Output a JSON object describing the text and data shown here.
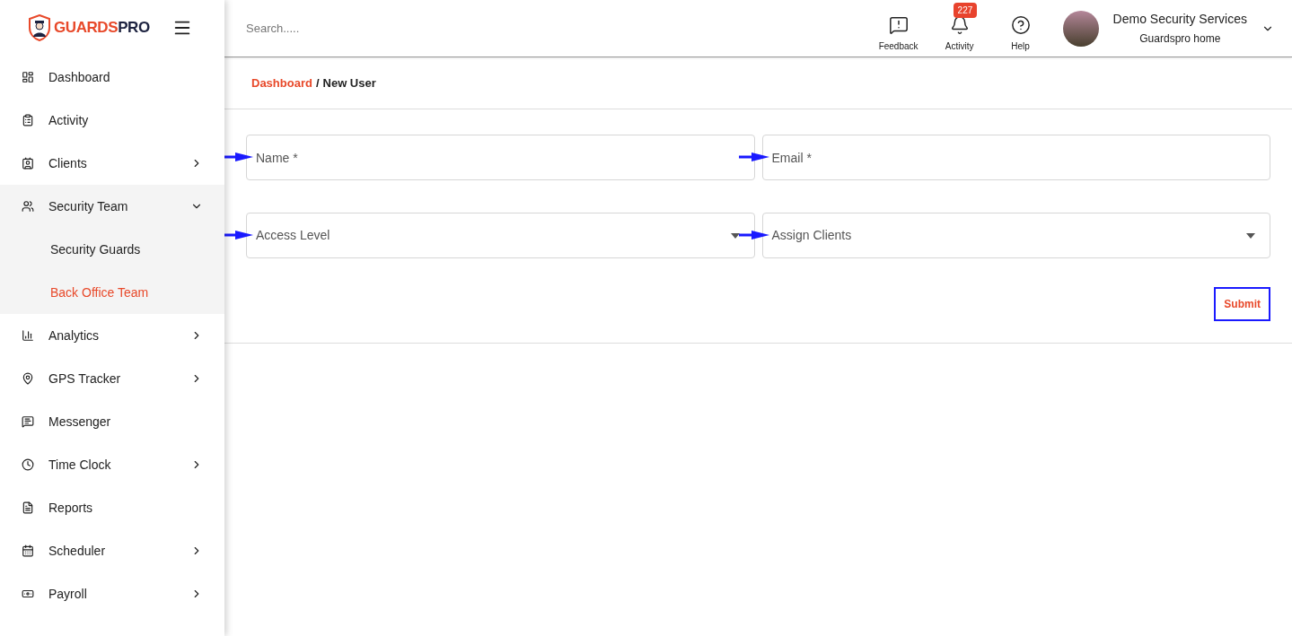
{
  "logo": {
    "brand_a": "GUARDS",
    "brand_b": "PRO"
  },
  "sidebar": {
    "items": [
      {
        "label": "Dashboard",
        "kind": "link",
        "selected": false
      },
      {
        "label": "Activity",
        "kind": "link",
        "selected": false
      },
      {
        "label": "Clients",
        "kind": "collapsed",
        "selected": false
      },
      {
        "label": "Security Team",
        "kind": "expanded",
        "selected": false,
        "children": [
          {
            "label": "Security Guards",
            "selected": false
          },
          {
            "label": "Back Office Team",
            "selected": true
          }
        ]
      },
      {
        "label": "Analytics",
        "kind": "collapsed",
        "selected": false
      },
      {
        "label": "GPS Tracker",
        "kind": "collapsed",
        "selected": false
      },
      {
        "label": "Messenger",
        "kind": "link",
        "selected": false
      },
      {
        "label": "Time Clock",
        "kind": "collapsed",
        "selected": false
      },
      {
        "label": "Reports",
        "kind": "link",
        "selected": false
      },
      {
        "label": "Scheduler",
        "kind": "collapsed",
        "selected": false
      },
      {
        "label": "Payroll",
        "kind": "collapsed",
        "selected": false
      }
    ]
  },
  "header": {
    "search": {
      "placeholder": "Search....."
    },
    "actions": [
      {
        "label": "Feedback"
      },
      {
        "label": "Activity",
        "badge": "227"
      },
      {
        "label": "Help"
      }
    ],
    "account": {
      "name": "Demo Security Services",
      "subtitle": "Guardspro home"
    }
  },
  "breadcrumb": {
    "items": [
      "Dashboard",
      "New User"
    ],
    "separator": "/"
  },
  "form": {
    "fields": [
      {
        "placeholder": "Name *",
        "kind": "text",
        "arrow": true
      },
      {
        "placeholder": "Email *",
        "kind": "text",
        "arrow": true
      },
      {
        "placeholder": "Access Level",
        "kind": "select",
        "arrow": true
      },
      {
        "placeholder": "Assign Clients",
        "kind": "select",
        "arrow": true
      }
    ],
    "submit": {
      "label": "Submit",
      "highlighted": true
    }
  }
}
